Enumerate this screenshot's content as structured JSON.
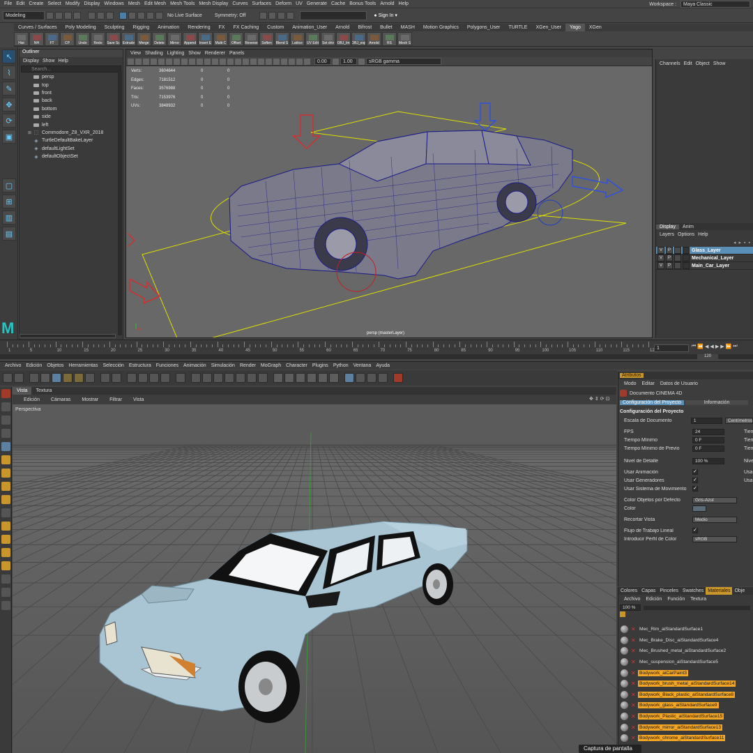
{
  "maya": {
    "menubar": [
      "File",
      "Edit",
      "Create",
      "Select",
      "Modify",
      "Display",
      "Windows",
      "Mesh",
      "Edit Mesh",
      "Mesh Tools",
      "Mesh Display",
      "Curves",
      "Surfaces",
      "Deform",
      "UV",
      "Generate",
      "Cache",
      "Bonus Tools",
      "Arnold",
      "Help"
    ],
    "workspace_label": "Workspace :",
    "workspace_value": "Maya Classic",
    "mode_select": "Modeling",
    "live_surface": "No Live Surface",
    "symmetry": "Symmetry: Off",
    "sign_in": "Sign In",
    "shelf_tabs": [
      "Curves / Surfaces",
      "Poly Modeling",
      "Sculpting",
      "Rigging",
      "Animation",
      "Rendering",
      "FX",
      "FX Caching",
      "Custom",
      "Animation_User",
      "Arnold",
      "Bifrost",
      "Bullet",
      "MASH",
      "Motion Graphics",
      "Polygons_User",
      "TURTLE",
      "XGen_User",
      "Yago",
      "XGen"
    ],
    "shelf_active": "Yago",
    "shelf_buttons": [
      "Hist",
      "NH",
      "FT",
      "CP",
      "Undo",
      "Redo",
      "Save Sc",
      "Extrude",
      "Merge",
      "Delete",
      "Mirror",
      "Append",
      "Insert E",
      "Multi-C",
      "Offset",
      "Reverse",
      "Soften",
      "Blend S",
      "Lattice",
      "UV Edit",
      "Set driv",
      "OBJ_Im",
      "OBJ_exp",
      "Arnold",
      "RS",
      "Mesh S"
    ],
    "outliner": {
      "title": "Outliner",
      "menus": [
        "Display",
        "Show",
        "Help"
      ],
      "search_placeholder": "Search...",
      "items": [
        {
          "label": "persp",
          "icon": "camera-icon"
        },
        {
          "label": "top",
          "icon": "camera-icon"
        },
        {
          "label": "front",
          "icon": "camera-icon"
        },
        {
          "label": "back",
          "icon": "camera-icon"
        },
        {
          "label": "bottom",
          "icon": "camera-icon"
        },
        {
          "label": "side",
          "icon": "camera-icon"
        },
        {
          "label": "left",
          "icon": "camera-icon"
        },
        {
          "label": "Commodore_Z8_VXR_2018",
          "icon": "group-icon"
        },
        {
          "label": "TurtleDefaultBakeLayer",
          "icon": "node-icon"
        },
        {
          "label": "defaultLightSet",
          "icon": "set-icon"
        },
        {
          "label": "defaultObjectSet",
          "icon": "set-icon"
        }
      ]
    },
    "viewport": {
      "menus": [
        "View",
        "Shading",
        "Lighting",
        "Show",
        "Renderer",
        "Panels"
      ],
      "exposure": "0.00",
      "gamma": "1.00",
      "color_space": "sRGB gamma",
      "camera_label": "persp (masterLayer)",
      "stats": [
        {
          "name": "Verts:",
          "v1": "3604644",
          "v2": "0",
          "v3": "0"
        },
        {
          "name": "Edges:",
          "v1": "7181512",
          "v2": "0",
          "v3": "0"
        },
        {
          "name": "Faces:",
          "v1": "3576988",
          "v2": "0",
          "v3": "0"
        },
        {
          "name": "Tris:",
          "v1": "7153976",
          "v2": "0",
          "v3": "0"
        },
        {
          "name": "UVs:",
          "v1": "3848932",
          "v2": "0",
          "v3": "0"
        }
      ]
    },
    "channelbox": {
      "menus": [
        "Channels",
        "Edit",
        "Object",
        "Show"
      ],
      "tabs": [
        "Display",
        "Anim"
      ],
      "layer_menus": [
        "Layers",
        "Options",
        "Help"
      ],
      "layers": [
        {
          "v": "V",
          "p": "P",
          "name": "Glass_Layer",
          "selected": true
        },
        {
          "v": "V",
          "p": "P",
          "name": "Mechanical_Layer",
          "selected": false
        },
        {
          "v": "V",
          "p": "P",
          "name": "Main_Car_Layer",
          "selected": false
        }
      ]
    },
    "timeline": {
      "ticks": [
        "1",
        "5",
        "10",
        "15",
        "20",
        "25",
        "30",
        "35",
        "40",
        "45",
        "50",
        "55",
        "60",
        "65",
        "70",
        "75",
        "80",
        "85",
        "90",
        "95",
        "100",
        "105",
        "110",
        "115",
        "120"
      ],
      "current_frame": "1",
      "end_frame": "120"
    }
  },
  "c4d": {
    "menubar": [
      "Archivo",
      "Edición",
      "Objetos",
      "Herramientas",
      "Selección",
      "Estructura",
      "Funciones",
      "Animación",
      "Simulación",
      "Render",
      "MoGraph",
      "Character",
      "Plugins",
      "Python",
      "Ventana",
      "Ayuda"
    ],
    "viewport_tabs": [
      "Vista",
      "Textura"
    ],
    "viewport_menus": [
      "Edición",
      "Cámaras",
      "Mostrar",
      "Filtrar",
      "Vista"
    ],
    "viewport_label": "Perspectiva",
    "attributes": {
      "title": "Atributos",
      "menus": [
        "Modo",
        "Editar",
        "Datos de Usuario"
      ],
      "document": "Documento CINEMA 4D",
      "tabs": [
        "Configuración del Proyecto",
        "Información"
      ],
      "section": "Configuración del Proyecto",
      "scale_label": "Escala de Documento",
      "scale_value": "1",
      "scale_unit": "Centímetros",
      "rows": [
        {
          "label": "FPS",
          "value": "24",
          "right": "Tiem"
        },
        {
          "label": "Tiempo Mínimo",
          "value": "0 F",
          "right": "Tiem"
        },
        {
          "label": "Tiempo Mínimo de Previo",
          "value": "0 F",
          "right": "Tiem"
        },
        {
          "label": "Nivel de Detalle",
          "value": "100 %",
          "right": "Nive"
        }
      ],
      "checks": [
        {
          "label": "Usar Animación",
          "right": "Usar"
        },
        {
          "label": "Usar Generadores",
          "right": "Usar"
        },
        {
          "label": "Usar Sistema de Movimiento",
          "right": ""
        }
      ],
      "color_objects_label": "Color Objetos por Defecto",
      "color_objects_value": "Gris-Azul",
      "color_label": "Color",
      "clip_label": "Recortar Vista",
      "clip_value": "Medio",
      "linear_label": "Flujo de Trabajo Lineal",
      "profile_label": "Introducir Perfil de Color",
      "profile_value": "sRGB"
    },
    "materials": {
      "tabs": [
        "Colores",
        "Capas",
        "Pinceles",
        "Swatches",
        "Materiales",
        "Obje"
      ],
      "active_tab": "Materiales",
      "menus": [
        "Archivo",
        "Edición",
        "Función",
        "Textura"
      ],
      "zoom": "100 %",
      "items": [
        {
          "name": "Mec_Rim_aiStandardSurface1",
          "highlight": false
        },
        {
          "name": "Mec_Brake_Disc_aiStandardSurface4",
          "highlight": false
        },
        {
          "name": "Mec_Brushed_metal_aiStandardSurface2",
          "highlight": false
        },
        {
          "name": "Mec_suspension_aiStandardSurface5",
          "highlight": false
        },
        {
          "name": "Bodywork_aiCarPaint3",
          "highlight": true
        },
        {
          "name": "Bodywork_brush_metal_aiStandardSurface14",
          "highlight": true
        },
        {
          "name": "Bodywork_Black_plastic_aiStandardSurface8",
          "highlight": true
        },
        {
          "name": "Bodywork_glass_aiStandardSurface9",
          "highlight": true
        },
        {
          "name": "Bodywork_Plastic_aiStandardSurface15",
          "highlight": true
        },
        {
          "name": "Bodywork_mirror_aiStandardSurface13",
          "highlight": true
        },
        {
          "name": "Bodywork_chrome_aiStandardSurface11",
          "highlight": true
        }
      ]
    },
    "tooltip": "Captura de pantalla"
  },
  "colors": {
    "maya_accent": "#5a8fb8",
    "c4d_highlight": "#f2a623",
    "wire": "#1a1a8a"
  }
}
